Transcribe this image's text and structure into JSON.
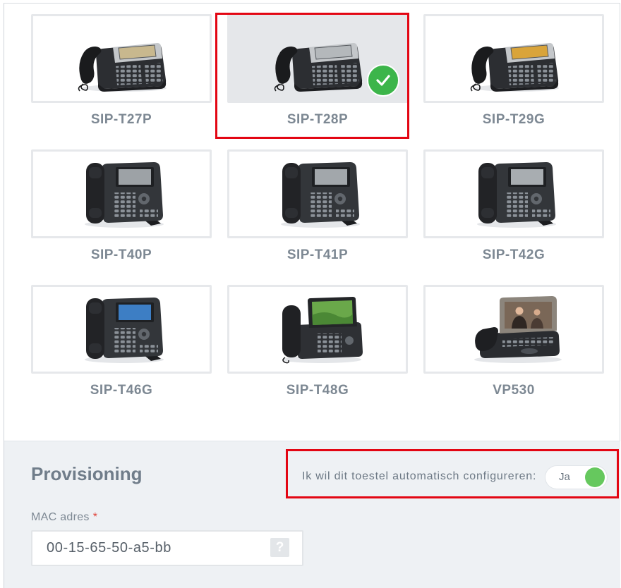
{
  "models": [
    {
      "name": "SIP-T27P",
      "selected": false,
      "screen_color": "#c8b88e"
    },
    {
      "name": "SIP-T28P",
      "selected": true,
      "screen_color": "#b4b8bb"
    },
    {
      "name": "SIP-T29G",
      "selected": false,
      "screen_color": "#d9a43a"
    },
    {
      "name": "SIP-T40P",
      "selected": false,
      "screen_color": "#9da2a6"
    },
    {
      "name": "SIP-T41P",
      "selected": false,
      "screen_color": "#a2a7ab"
    },
    {
      "name": "SIP-T42G",
      "selected": false,
      "screen_color": "#a8adb1"
    },
    {
      "name": "SIP-T46G",
      "selected": false,
      "screen_color": "#3d7ec4"
    },
    {
      "name": "SIP-T48G",
      "selected": false,
      "screen_color": "#6aa84a"
    },
    {
      "name": "VP530",
      "selected": false,
      "screen_color": "#7a6757"
    }
  ],
  "provisioning": {
    "title": "Provisioning",
    "auto_config_label": "Ik wil dit toestel automatisch configureren:",
    "auto_config_value": "Ja",
    "auto_config_on": true,
    "mac_label": "MAC adres",
    "required_mark": "*",
    "mac_value": "00-15-65-50-a5-bb",
    "help_glyph": "?"
  },
  "icons": {
    "selected_badge": "check-icon",
    "mac_help": "help-icon",
    "model_image": "desk-phone-icon"
  },
  "colors": {
    "selected_badge": "#3cb54a",
    "toggle_on": "#66c85e",
    "required_mark": "#e0453c",
    "highlight_outline": "#e30613",
    "card_border": "#e6e8eb",
    "section_background": "#eef1f4"
  }
}
